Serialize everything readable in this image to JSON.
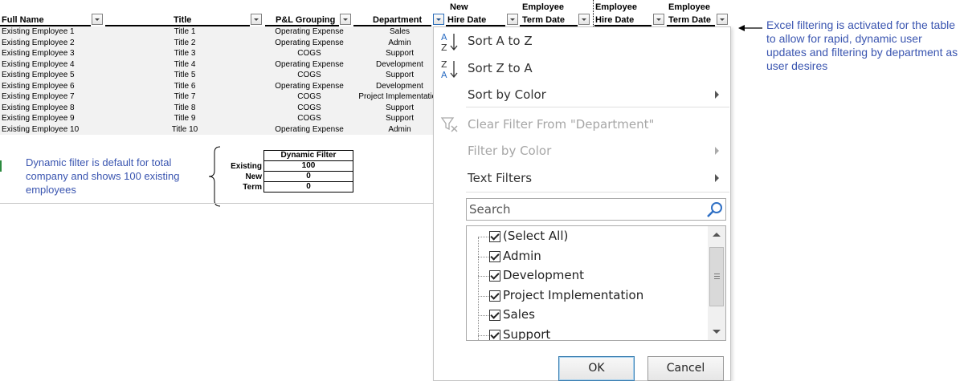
{
  "headers": {
    "full_name": "Full Name",
    "title": "Title",
    "pl_grouping": "P&L Grouping",
    "department": "Department",
    "new_hire_top": "New",
    "new_hire_bottom": "Hire Date",
    "emp_term_top": "Employee",
    "emp_term_bottom": "Term Date",
    "emp_hire_top": "Employee",
    "emp_hire_bottom": "Hire Date",
    "emp_term2_top": "Employee",
    "emp_term2_bottom": "Term Date"
  },
  "rows": [
    {
      "name": "Existing Employee 1",
      "title": "Title 1",
      "pl": "Operating Expense",
      "dept": "Sales"
    },
    {
      "name": "Existing Employee 2",
      "title": "Title 2",
      "pl": "Operating Expense",
      "dept": "Admin"
    },
    {
      "name": "Existing Employee 3",
      "title": "Title 3",
      "pl": "COGS",
      "dept": "Support"
    },
    {
      "name": "Existing Employee 4",
      "title": "Title 4",
      "pl": "Operating Expense",
      "dept": "Development"
    },
    {
      "name": "Existing Employee 5",
      "title": "Title 5",
      "pl": "COGS",
      "dept": "Support"
    },
    {
      "name": "Existing Employee 6",
      "title": "Title 6",
      "pl": "Operating Expense",
      "dept": "Development"
    },
    {
      "name": "Existing Employee 7",
      "title": "Title 7",
      "pl": "COGS",
      "dept": "Project Implementation"
    },
    {
      "name": "Existing Employee 8",
      "title": "Title 8",
      "pl": "COGS",
      "dept": "Support"
    },
    {
      "name": "Existing Employee 9",
      "title": "Title 9",
      "pl": "COGS",
      "dept": "Support"
    },
    {
      "name": "Existing Employee 10",
      "title": "Title 10",
      "pl": "Operating Expense",
      "dept": "Admin"
    }
  ],
  "dynamic_filter": {
    "note": "Dynamic filter is default for total company and shows 100 existing employees",
    "header": "Dynamic Filter",
    "existing_label": "Existing",
    "existing_value": "100",
    "new_label": "New",
    "new_value": "0",
    "term_label": "Term",
    "term_value": "0"
  },
  "menu": {
    "sort_az": "Sort A to Z",
    "sort_za": "Sort Z to A",
    "sort_color": "Sort by Color",
    "clear_filter": "Clear Filter From \"Department\"",
    "filter_color": "Filter by Color",
    "text_filters": "Text Filters",
    "search_placeholder": "Search",
    "items": [
      "(Select All)",
      "Admin",
      "Development",
      "Project Implementation",
      "Sales",
      "Support"
    ],
    "ok": "OK",
    "cancel": "Cancel"
  },
  "annotation": {
    "excel_note": "Excel filtering is activated for the table to allow for rapid, dynamic user updates and filtering by department as user desires"
  },
  "colors": {
    "note_blue": "#3a55b0",
    "row_bg": "#f2f2f2"
  }
}
